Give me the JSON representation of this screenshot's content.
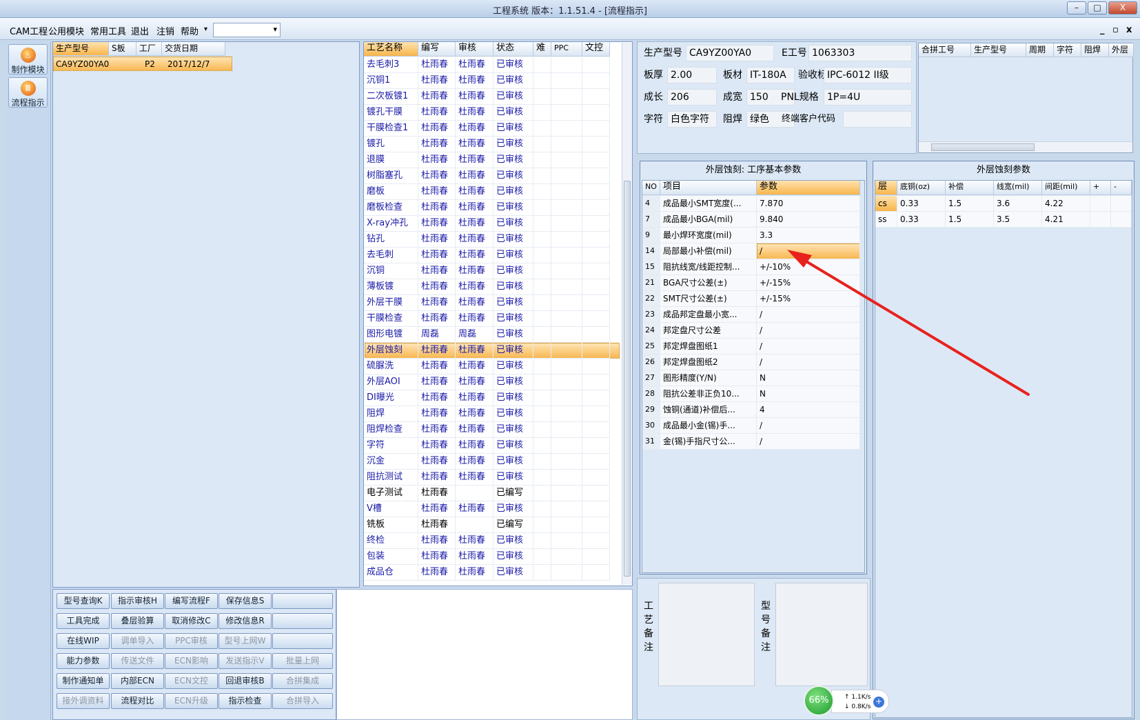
{
  "window": {
    "title": "工程系统   版本：1.1.51.4 - [流程指示]",
    "min_btn": "–",
    "max_btn": "□",
    "close_btn": "X"
  },
  "menu": {
    "items": [
      "CAM工程",
      "公用模块",
      "常用工具",
      "退出",
      "注销",
      "帮助"
    ],
    "dropdown_arrow": "▾",
    "combo_value": "",
    "mdi": [
      "_",
      "▫",
      "x"
    ]
  },
  "nav": [
    {
      "label": "制作模块",
      "icon": "fire-icon"
    },
    {
      "label": "流程指示",
      "icon": "flow-icon"
    }
  ],
  "model_list": {
    "headers": [
      "生产型号",
      "S板",
      "工厂",
      "交货日期"
    ],
    "rows": [
      [
        "CA9YZ00YA0",
        "",
        "P2",
        "2017/12/7"
      ]
    ]
  },
  "process_list": {
    "headers": [
      "工艺名称",
      "编写",
      "审核",
      "状态",
      "难",
      "PPC",
      "文控"
    ],
    "selected_index": 18,
    "rows": [
      [
        "去毛刺3",
        "杜雨春",
        "杜雨春",
        "已审核"
      ],
      [
        "沉铜1",
        "杜雨春",
        "杜雨春",
        "已审核"
      ],
      [
        "二次板镀1",
        "杜雨春",
        "杜雨春",
        "已审核"
      ],
      [
        "镀孔干膜",
        "杜雨春",
        "杜雨春",
        "已审核"
      ],
      [
        "干膜检查1",
        "杜雨春",
        "杜雨春",
        "已审核"
      ],
      [
        "镀孔",
        "杜雨春",
        "杜雨春",
        "已审核"
      ],
      [
        "退膜",
        "杜雨春",
        "杜雨春",
        "已审核"
      ],
      [
        "树脂塞孔",
        "杜雨春",
        "杜雨春",
        "已审核"
      ],
      [
        "磨板",
        "杜雨春",
        "杜雨春",
        "已审核"
      ],
      [
        "磨板检查",
        "杜雨春",
        "杜雨春",
        "已审核"
      ],
      [
        "X-ray冲孔",
        "杜雨春",
        "杜雨春",
        "已审核"
      ],
      [
        "钻孔",
        "杜雨春",
        "杜雨春",
        "已审核"
      ],
      [
        "去毛刺",
        "杜雨春",
        "杜雨春",
        "已审核"
      ],
      [
        "沉铜",
        "杜雨春",
        "杜雨春",
        "已审核"
      ],
      [
        "薄板镀",
        "杜雨春",
        "杜雨春",
        "已审核"
      ],
      [
        "外层干膜",
        "杜雨春",
        "杜雨春",
        "已审核"
      ],
      [
        "干膜检查",
        "杜雨春",
        "杜雨春",
        "已审核"
      ],
      [
        "图形电镀",
        "周磊",
        "周磊",
        "已审核"
      ],
      [
        "外层蚀刻",
        "杜雨春",
        "杜雨春",
        "已审核"
      ],
      [
        "硫脲洗",
        "杜雨春",
        "杜雨春",
        "已审核"
      ],
      [
        "外层AOI",
        "杜雨春",
        "杜雨春",
        "已审核"
      ],
      [
        "DI曝光",
        "杜雨春",
        "杜雨春",
        "已审核"
      ],
      [
        "阻焊",
        "杜雨春",
        "杜雨春",
        "已审核"
      ],
      [
        "阻焊检查",
        "杜雨春",
        "杜雨春",
        "已审核"
      ],
      [
        "字符",
        "杜雨春",
        "杜雨春",
        "已审核"
      ],
      [
        "沉金",
        "杜雨春",
        "杜雨春",
        "已审核"
      ],
      [
        "阻抗测试",
        "杜雨春",
        "杜雨春",
        "已审核"
      ],
      [
        "电子测试",
        "杜雨春",
        "",
        "已编写"
      ],
      [
        "V槽",
        "杜雨春",
        "杜雨春",
        "已审核"
      ],
      [
        "铣板",
        "杜雨春",
        "",
        "已编写"
      ],
      [
        "终检",
        "杜雨春",
        "杜雨春",
        "已审核"
      ],
      [
        "包装",
        "杜雨春",
        "杜雨春",
        "已审核"
      ],
      [
        "成品仓",
        "杜雨春",
        "杜雨春",
        "已审核"
      ]
    ]
  },
  "info": {
    "prod_model_label": "生产型号",
    "prod_model": "CA9YZ00YA0",
    "e_no_label": "E工号",
    "e_no": "1063303",
    "thickness_label": "板厚",
    "thickness": "2.00",
    "material_label": "板材",
    "material": "IT-180A",
    "standard_label": "验收标准",
    "standard": "IPC-6012 II级",
    "length_label": "成长",
    "length": "206",
    "width_label": "成宽",
    "width": "150",
    "pnl_label": "PNL规格",
    "pnl": "1P=4U",
    "char_label": "字符",
    "char": "白色字符",
    "mask_label": "阻焊",
    "mask": "绿色",
    "customer_label": "终端客户代码",
    "customer": ""
  },
  "combine_grid": {
    "headers": [
      "合拼工号",
      "生产型号",
      "周期",
      "字符",
      "阻焊",
      "外层"
    ]
  },
  "params": {
    "title": "外层蚀刻: 工序基本参数",
    "headers": [
      "NO",
      "项目",
      "参数"
    ],
    "selected_index": 3,
    "rows": [
      [
        "4",
        "成品最小SMT宽度(...",
        "7.870"
      ],
      [
        "7",
        "成品最小BGA(mil)",
        "9.840"
      ],
      [
        "9",
        "最小焊环宽度(mil)",
        "3.3"
      ],
      [
        "14",
        "局部最小补偿(mil)",
        "/"
      ],
      [
        "15",
        "阻抗线宽/线距控制...",
        "+/-10%"
      ],
      [
        "21",
        "BGA尺寸公差(±)",
        "+/-15%"
      ],
      [
        "22",
        "SMT尺寸公差(±)",
        "+/-15%"
      ],
      [
        "23",
        "成品邦定盘最小宽...",
        "/"
      ],
      [
        "24",
        "邦定盘尺寸公差",
        "/"
      ],
      [
        "25",
        "邦定焊盘图纸1",
        "/"
      ],
      [
        "26",
        "邦定焊盘图纸2",
        "/"
      ],
      [
        "27",
        "图形精度(Y/N)",
        "N"
      ],
      [
        "28",
        "阻抗公差非正负10...",
        "N"
      ],
      [
        "29",
        "蚀铜(通道)补偿后...",
        "4"
      ],
      [
        "30",
        "成品最小金(锡)手...",
        "/"
      ],
      [
        "31",
        "金(锡)手指尺寸公...",
        "/"
      ]
    ]
  },
  "etch": {
    "title": "外层蚀刻参数",
    "headers": [
      "层",
      "底铜(oz)",
      "补偿",
      "线宽(mil)",
      "间距(mil)",
      "+",
      "-"
    ],
    "rows": [
      [
        "cs",
        "0.33",
        "1.5",
        "3.6",
        "4.22"
      ],
      [
        "ss",
        "0.33",
        "1.5",
        "3.5",
        "4.21"
      ]
    ]
  },
  "notes": {
    "process_note_label": [
      "工",
      "艺",
      "备",
      "注"
    ],
    "model_note_label": [
      "型",
      "号",
      "备",
      "注"
    ]
  },
  "buttons": [
    [
      "型号查询K",
      "指示审核H",
      "编写流程F",
      "保存信息S",
      ""
    ],
    [
      "工具完成",
      "叠层验算",
      "取消修改C",
      "修改信息R",
      ""
    ],
    [
      "在线WIP",
      "调单导入",
      "PPC审核",
      "型号上网W",
      ""
    ],
    [
      "能力参数",
      "传送文件",
      "ECN影响",
      "发送指示V",
      "批量上网"
    ],
    [
      "制作通知单",
      "内部ECN",
      "ECN文控",
      "回退审核B",
      "合拼集成"
    ],
    [
      "接外调资料",
      "流程对比",
      "ECN升级",
      "指示检查",
      "合拼导入"
    ]
  ],
  "buttons_disabled": [
    [
      0,
      0,
      0,
      0,
      0
    ],
    [
      0,
      0,
      0,
      0,
      0
    ],
    [
      0,
      1,
      1,
      1,
      0
    ],
    [
      0,
      1,
      1,
      1,
      1
    ],
    [
      0,
      0,
      1,
      0,
      1
    ],
    [
      1,
      0,
      1,
      0,
      1
    ]
  ],
  "net": {
    "percent": "66%",
    "up": "1.1K/s",
    "down": "0.8K/s"
  },
  "colors": {
    "accent": "#f8b853",
    "arrow": "#e8211d",
    "text_blue": "#1a1aa8"
  }
}
